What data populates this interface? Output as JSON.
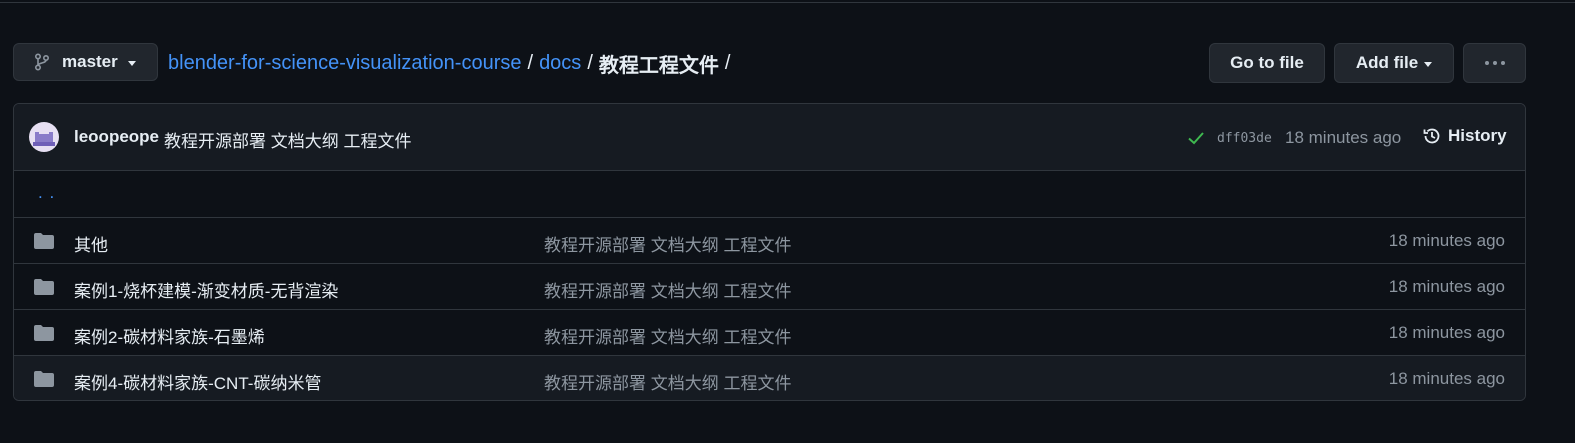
{
  "branch": {
    "name": "master",
    "icon": "git-branch-icon"
  },
  "breadcrumb": {
    "repo": "blender-for-science-visualization-course",
    "folder": "docs",
    "current": "教程工程文件",
    "separator": "/"
  },
  "actions": {
    "go_to_file": "Go to file",
    "add_file": "Add file"
  },
  "commit": {
    "author": "leoopeope",
    "message": "教程开源部署 文档大纲 工程文件",
    "sha": "dff03de",
    "time": "18 minutes ago",
    "history_label": "History",
    "status_color": "#3fb950"
  },
  "parent_link": ". .",
  "rows": [
    {
      "name": "其他",
      "message": "教程开源部署 文档大纲 工程文件",
      "time": "18 minutes ago",
      "icon": "folder-icon"
    },
    {
      "name": "案例1-烧杯建模-渐变材质-无背渲染",
      "message": "教程开源部署 文档大纲 工程文件",
      "time": "18 minutes ago",
      "icon": "folder-icon"
    },
    {
      "name": "案例2-碳材料家族-石墨烯",
      "message": "教程开源部署 文档大纲 工程文件",
      "time": "18 minutes ago",
      "icon": "folder-icon"
    },
    {
      "name": "案例4-碳材料家族-CNT-碳纳米管",
      "message": "教程开源部署 文档大纲 工程文件",
      "time": "18 minutes ago",
      "icon": "folder-icon"
    }
  ],
  "colors": {
    "background": "#0d1117",
    "link": "#4493f8",
    "muted": "#8d96a0",
    "border": "#30363d"
  }
}
